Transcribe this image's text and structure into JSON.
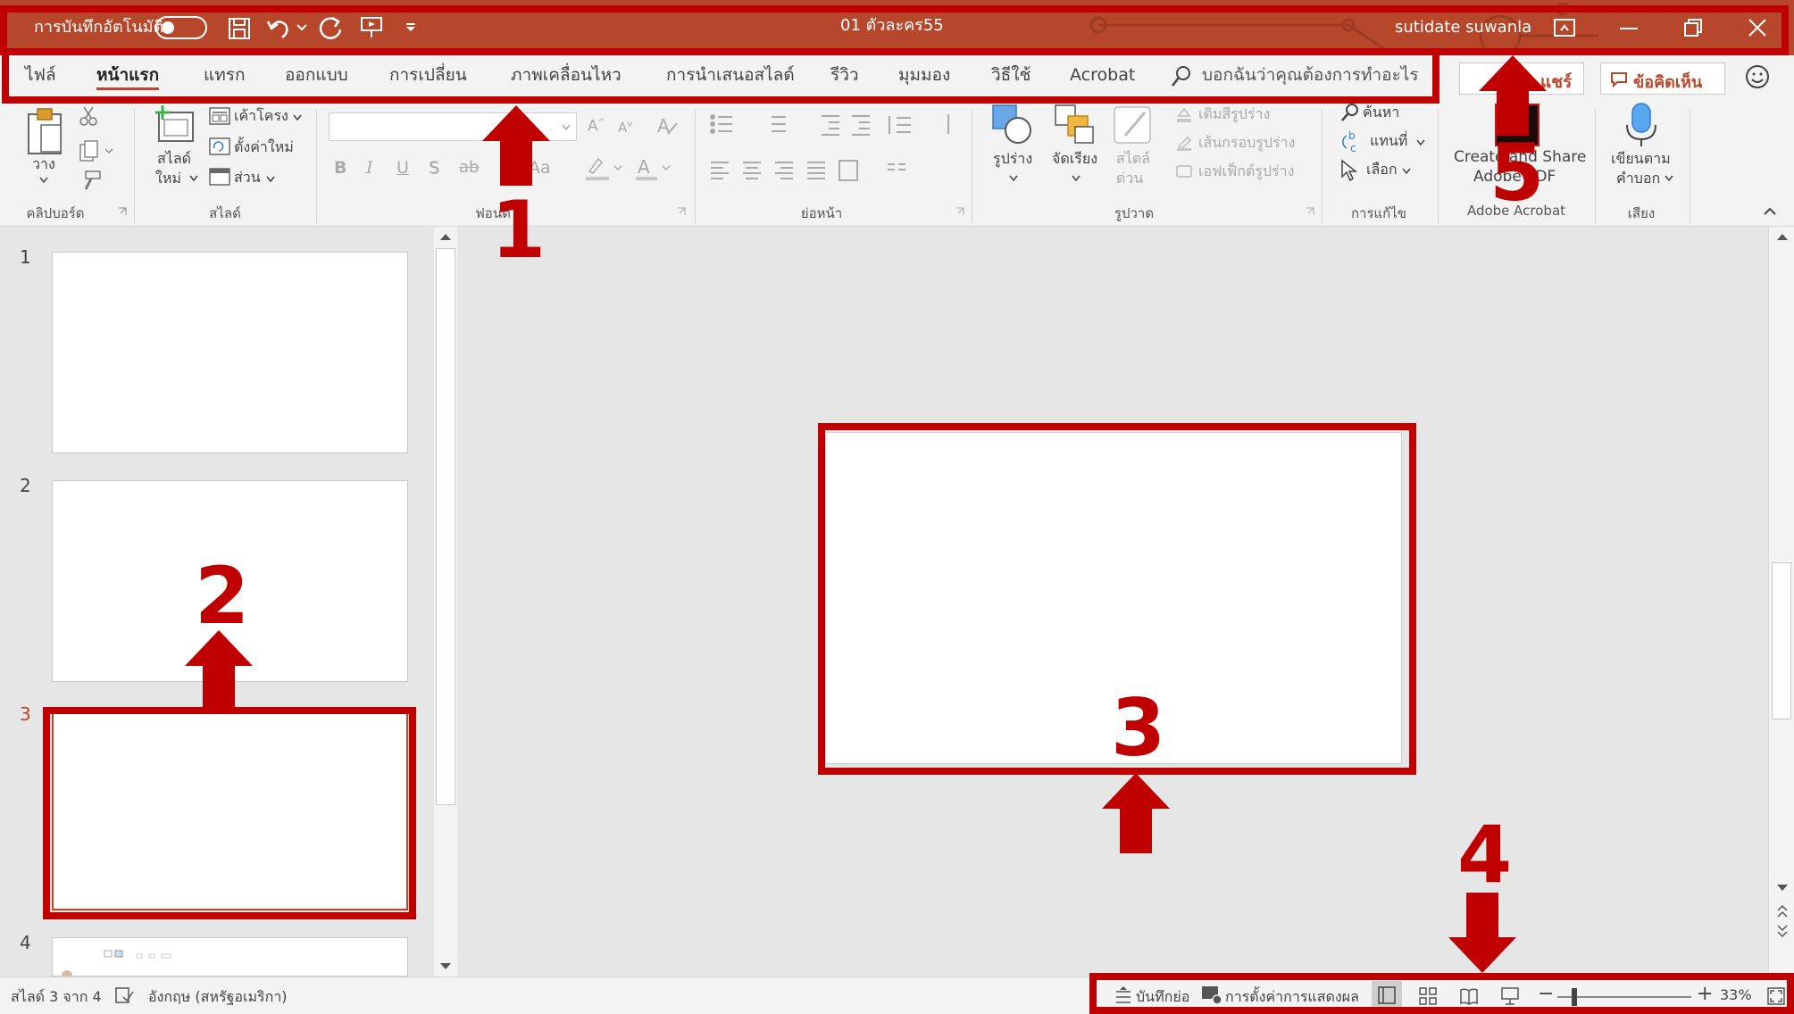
{
  "titlebar": {
    "autosave_label": "การบันทึกอัตโนมัติ",
    "doc_title": "01 ตัวละคร55",
    "user_name": "sutidate suwanla"
  },
  "tabs": [
    {
      "label": "ไฟล์"
    },
    {
      "label": "หน้าแรก"
    },
    {
      "label": "แทรก"
    },
    {
      "label": "ออกแบบ"
    },
    {
      "label": "การเปลี่ยน"
    },
    {
      "label": "ภาพเคลื่อนไหว"
    },
    {
      "label": "การนำเสนอสไลด์"
    },
    {
      "label": "รีวิว"
    },
    {
      "label": "มุมมอง"
    },
    {
      "label": "วิธีใช้"
    },
    {
      "label": "Acrobat"
    }
  ],
  "tell_me_placeholder": "บอกฉันว่าคุณต้องการทำอะไร",
  "share_label": "แชร์",
  "comments_label": "ข้อคิดเห็น",
  "ribbon": {
    "clipboard": {
      "paste": "วาง",
      "label": "คลิปบอร์ด"
    },
    "slides": {
      "new_slide_1": "สไลด์",
      "new_slide_2": "ใหม่",
      "layout": "เค้าโครง",
      "reset": "ตั้งค่าใหม่",
      "section": "ส่วน",
      "label": "สไลด์"
    },
    "font": {
      "bold": "B",
      "italic": "I",
      "underline": "U",
      "shadow": "S",
      "strike": "ab",
      "case": "Aa",
      "label": "ฟอนต์"
    },
    "paragraph": {
      "label": "ย่อหน้า"
    },
    "drawing": {
      "shapes": "รูปร่าง",
      "arrange": "จัดเรียง",
      "styles_1": "สไตล์",
      "styles_2": "ด่วน",
      "fill": "เติมสีรูปร่าง",
      "outline": "เส้นกรอบรูปร่าง",
      "effects": "เอฟเฟ็กต์รูปร่าง",
      "label": "รูปวาด"
    },
    "editing": {
      "find": "ค้นหา",
      "replace": "แทนที่",
      "select": "เลือก",
      "label": "การแก้ไข"
    },
    "acrobat": {
      "line1": "Create and Share",
      "line2": "Adobe PDF",
      "label": "Adobe Acrobat"
    },
    "voice": {
      "line1": "เขียนตาม",
      "line2": "คำบอก",
      "label": "เสียง"
    }
  },
  "slides": [
    {
      "number": "1"
    },
    {
      "number": "2"
    },
    {
      "number": "3"
    },
    {
      "number": "4"
    }
  ],
  "annotations": [
    "1",
    "2",
    "3",
    "4",
    "5"
  ],
  "statusbar": {
    "slide_info": "สไลด์ 3 จาก 4",
    "language": "อังกฤษ (สหรัฐอเมริกา)",
    "notes": "บันทึกย่อ",
    "display_settings": "การตั้งค่าการแสดงผล",
    "zoom_level": 33,
    "zoom": "33%",
    "minus": "−",
    "plus": "+"
  },
  "colors": {
    "accent": "#b7472a",
    "annotation": "#c00000",
    "active_slide": "#b7472a"
  },
  "icons": [
    "save-icon",
    "undo-icon",
    "redo-icon",
    "present-icon",
    "search-icon",
    "close-icon",
    "minimize-icon",
    "restore-icon",
    "smiley-icon",
    "microphone-icon"
  ]
}
